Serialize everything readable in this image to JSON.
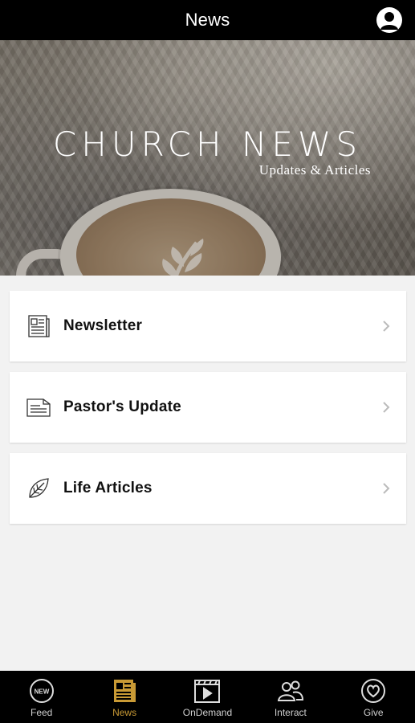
{
  "header": {
    "title": "News"
  },
  "hero": {
    "title": "CHURCH NEWS",
    "subtitle": "Updates & Articles"
  },
  "items": [
    {
      "label": "Newsletter"
    },
    {
      "label": "Pastor's Update"
    },
    {
      "label": "Life Articles"
    }
  ],
  "tabs": [
    {
      "label": "Feed",
      "badge": "NEW"
    },
    {
      "label": "News"
    },
    {
      "label": "OnDemand"
    },
    {
      "label": "Interact"
    },
    {
      "label": "Give"
    }
  ],
  "colors": {
    "accent": "#c99a35",
    "bar": "#000000",
    "background": "#f2f2f2"
  }
}
